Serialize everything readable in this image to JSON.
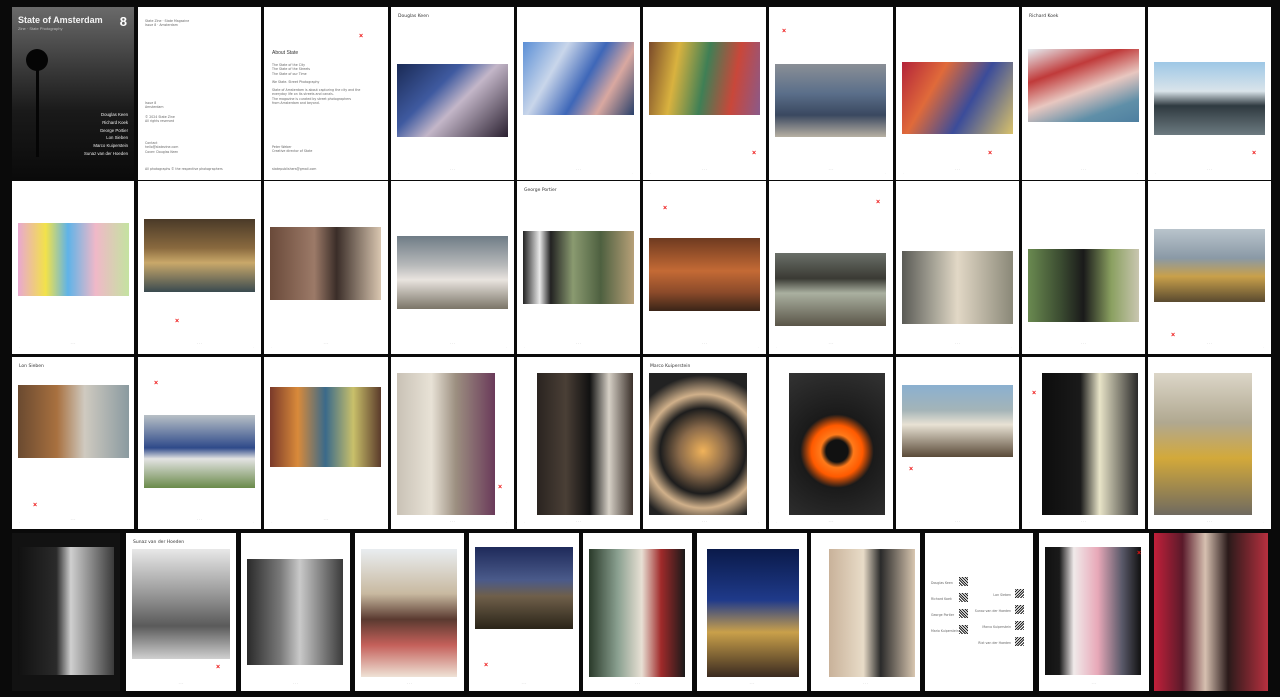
{
  "cover": {
    "title": "State of Amsterdam",
    "subtitle": "Zine · State Photography",
    "number": "8",
    "contributors": [
      "Douglas Keen",
      "Richard Koek",
      "George Portier",
      "Lon Sieben",
      "Marco Kuiperstein",
      "Sunaz van der Hoeden"
    ]
  },
  "intro": {
    "title": "About State",
    "lines_a": [
      "The State of the City",
      "The State of the Streets",
      "The State of our Time"
    ],
    "line_b": "We State. Street Photography",
    "body": [
      "State of Amsterdam is about capturing the city and the",
      "everyday life on its streets and canals.",
      "The magazine is curated by street photographers",
      "from Amsterdam and beyond."
    ],
    "contact": [
      "Peter Weber",
      "Creative director of State"
    ],
    "footer": "statepublishers@gmail.com"
  },
  "colophon": {
    "head": [
      "State Zine · State Magazine",
      "Issue 8 · Amsterdam"
    ],
    "block1": [
      "Issue 8",
      "Amsterdam"
    ],
    "block2": [
      "© 2024 State Zine",
      "All rights reserved"
    ],
    "block3": [
      "Contact",
      "hello@statezine.com",
      "Cover: Douglas Keen"
    ],
    "footer": "All photographs © the respective photographers"
  },
  "contacts": {
    "left": [
      "Douglas Keen",
      "Richard Koek",
      "George Portier",
      "Mario Kuiperstein"
    ],
    "right": [
      "Lon Sieben",
      "Sunaz van der Hoeden",
      "Marco Kuiperstein",
      "Rixt van der Hoeden"
    ]
  },
  "photographers": [
    "Douglas Keen",
    "Richard Koek",
    "George Portier",
    "Lon Sieben",
    "Marco Kuiperstein",
    "Sunaz van der Hoeden"
  ]
}
